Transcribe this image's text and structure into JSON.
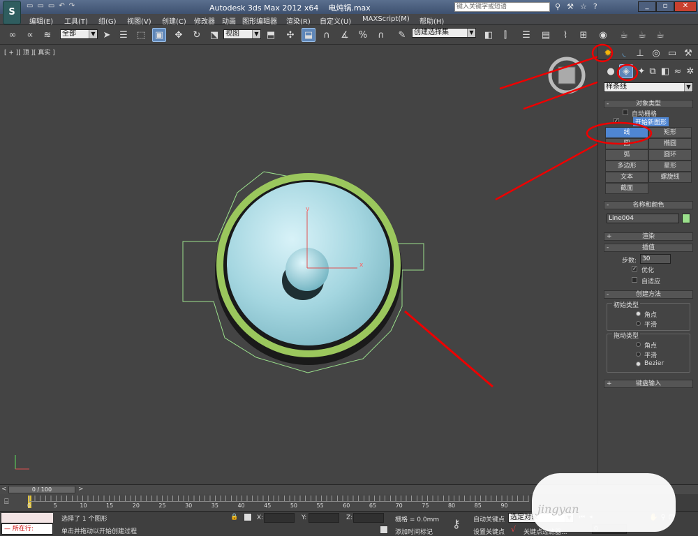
{
  "title": {
    "app": "Autodesk 3ds Max  2012 x64",
    "file": "电炖锅.max",
    "search_placeholder": "键入关键字或短语"
  },
  "menu": [
    "编辑(E)",
    "工具(T)",
    "组(G)",
    "视图(V)",
    "创建(C)",
    "修改器",
    "动画",
    "图形编辑器",
    "渲染(R)",
    "自定义(U)",
    "MAXScript(M)",
    "帮助(H)"
  ],
  "toolbar": {
    "filter": "全部",
    "ref_coord": "视图",
    "selection_set": "创建选择集"
  },
  "viewport": {
    "label": "[ + ][ 顶 ][ 真实 ]",
    "axis_x": "x",
    "axis_y": "y"
  },
  "panel": {
    "category": "样条线",
    "object_type": {
      "header": "对象类型",
      "auto_grid": "自动栅格",
      "start_new_shape": "开始新图形",
      "buttons": [
        [
          "线",
          "矩形"
        ],
        [
          "圆",
          "椭圆"
        ],
        [
          "弧",
          "圆环"
        ],
        [
          "多边形",
          "星形"
        ],
        [
          "文本",
          "螺旋线"
        ],
        [
          "截面",
          ""
        ]
      ]
    },
    "name_color": {
      "header": "名称和颜色",
      "name": "Line004",
      "color": "#9be08c"
    },
    "render": {
      "header": "渲染"
    },
    "interp": {
      "header": "插值",
      "steps_label": "步数:",
      "steps": "30",
      "optimize": "优化",
      "adaptive": "自适应"
    },
    "creation": {
      "header": "创建方法",
      "initial": "初始类型",
      "corner": "角点",
      "smooth": "平滑",
      "drag": "拖动类型",
      "corner2": "角点",
      "smooth2": "平滑",
      "bezier": "Bezier"
    },
    "keyboard": {
      "header": "键盘输入"
    }
  },
  "timeline": {
    "frame": "0 / 100",
    "ticks": [
      "0",
      "5",
      "10",
      "15",
      "20",
      "25",
      "30",
      "35",
      "40",
      "45",
      "50",
      "55",
      "60",
      "65",
      "70",
      "75",
      "80",
      "85",
      "90"
    ]
  },
  "status": {
    "running": "所在行:",
    "selected": "选择了 1 个图形",
    "hint": "单击并拖动以开始创建过程",
    "x": "X:",
    "y": "Y:",
    "z": "Z:",
    "grid": "栅格 = 0.0mm",
    "add_tag": "添加时间标记",
    "auto_key": "自动关键点",
    "set_key": "设置关键点",
    "sel_obj": "选定对象",
    "key_filter": "关键点过滤器...",
    "frame_val": "0"
  },
  "watermark": "jingyan"
}
